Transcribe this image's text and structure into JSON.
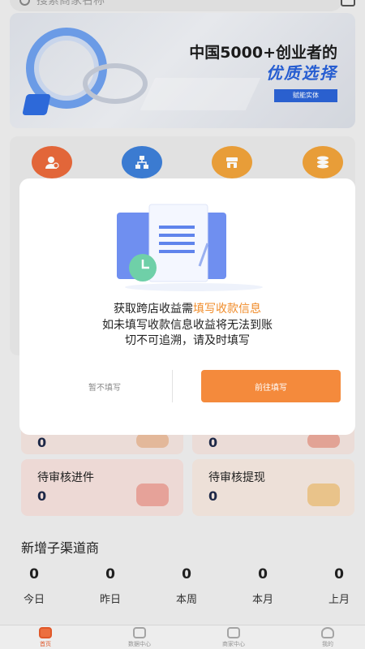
{
  "search": {
    "placeholder": "搜索商家名称"
  },
  "banner": {
    "line1": "中国5000+创业者的",
    "line2": "优质选择",
    "pill": "赋能实体"
  },
  "stats": [
    {
      "label": "",
      "value": "0",
      "color": "#f5e3de"
    },
    {
      "label": "",
      "value": "0",
      "color": "#f5e3de"
    },
    {
      "label": "待审核进件",
      "value": "0",
      "color": "#f7e0dc"
    },
    {
      "label": "待审核提现",
      "value": "0",
      "color": "#f7e9df"
    }
  ],
  "new_channel": {
    "title": "新增子渠道商",
    "items": [
      {
        "value": "0",
        "label": "今日"
      },
      {
        "value": "0",
        "label": "昨日"
      },
      {
        "value": "0",
        "label": "本周"
      },
      {
        "value": "0",
        "label": "本月"
      },
      {
        "value": "0",
        "label": "上月"
      }
    ]
  },
  "tabs": [
    "首页",
    "数据中心",
    "商家中心",
    "我的"
  ],
  "modal": {
    "line1_prefix": "获取跨店收益需",
    "line1_highlight": "填写收款信息",
    "line2": "如未填写收款信息收益将无法到账",
    "line3": "切不可追溯，请及时填写",
    "skip_label": "暂不填写",
    "go_label": "前往填写"
  },
  "colors": {
    "accent": "#f48a3c",
    "highlight": "#f08c2a",
    "tab_active": "#e85b2b"
  }
}
